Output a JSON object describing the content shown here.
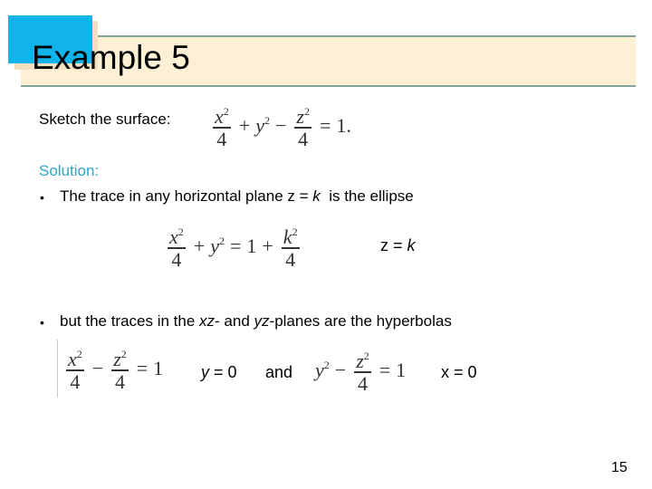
{
  "slide": {
    "title": "Example 5",
    "prompt_label": "Sketch the surface:",
    "surface_equation": {
      "term1_num": "x",
      "term1_den": "4",
      "op1": "+",
      "term2": "y",
      "op2": "−",
      "term3_num": "z",
      "term3_den": "4",
      "eq": "=",
      "rhs": "1."
    },
    "solution_label": "Solution:",
    "bullets": [
      {
        "marker": "•",
        "text_before": "The trace in any horizontal plane z = ",
        "italic": "k",
        "text_after": "  is the ellipse"
      },
      {
        "marker": "•",
        "text_parts": [
          "but the traces in the ",
          "xz",
          "- and ",
          "yz",
          "-planes are the hyperbolas"
        ]
      }
    ],
    "ellipse_equation": {
      "term1_num": "x",
      "term1_den": "4",
      "op1": "+",
      "term2": "y",
      "eq": "=",
      "one": "1",
      "op2": "+",
      "term3_num": "k",
      "term3_den": "4"
    },
    "ellipse_condition": {
      "left": "z",
      "eq": "=",
      "right": "k"
    },
    "hyperbola_xz": {
      "term1_num": "x",
      "term1_den": "4",
      "op": "−",
      "term2_num": "z",
      "term2_den": "4",
      "eq": "=",
      "rhs": "1"
    },
    "hyperbola_xz_condition": {
      "left": "y",
      "eq": "=",
      "right": "0"
    },
    "connector": "and",
    "hyperbola_yz": {
      "term1": "y",
      "op": "−",
      "term2_num": "z",
      "term2_den": "4",
      "eq": "=",
      "rhs": "1"
    },
    "hyperbola_yz_condition": {
      "left": "x",
      "eq": "=",
      "right": "0"
    },
    "exponent": "2",
    "page_number": "15"
  },
  "colors": {
    "banner_fill": "#fdf0d5",
    "banner_rule": "#7fa59a",
    "accent_square": "#10b4ea",
    "accent_shadow": "#f2dfbd",
    "solution_label": "#2fa5c4"
  }
}
